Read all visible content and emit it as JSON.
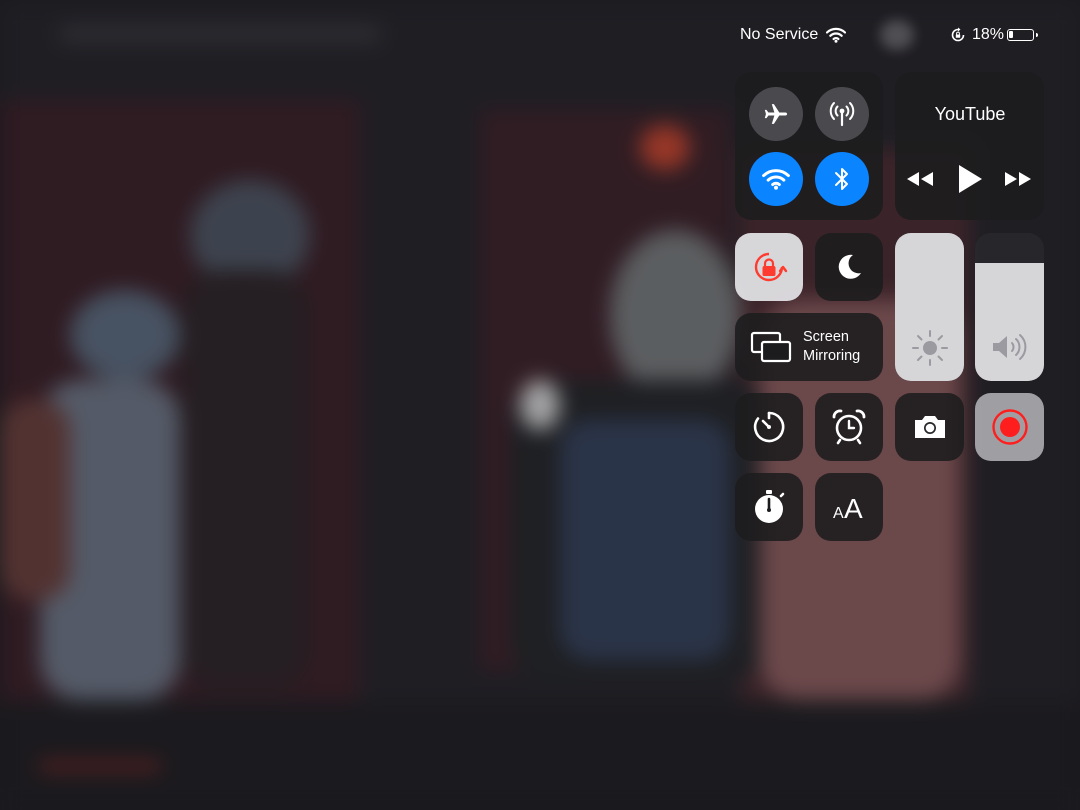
{
  "status_bar": {
    "carrier": "No Service",
    "battery_percent": "18%",
    "battery_level": 0.18,
    "icons": [
      "wifi-icon",
      "orientation-lock-icon",
      "battery-icon"
    ]
  },
  "control_center": {
    "connectivity": {
      "airplane_mode": false,
      "cellular_data": false,
      "wifi": true,
      "bluetooth": true,
      "active_color": "#0a84ff"
    },
    "now_playing": {
      "app": "YouTube",
      "controls": [
        "rewind-icon",
        "play-icon",
        "fast-forward-icon"
      ]
    },
    "orientation_lock": {
      "on": true,
      "accent_color": "#ff3b30"
    },
    "do_not_disturb": {
      "on": false
    },
    "screen_mirroring": {
      "line1": "Screen",
      "line2": "Mirroring"
    },
    "brightness_level": 1.0,
    "volume_level": 0.8,
    "shortcuts": [
      "timer-icon",
      "alarm-icon",
      "camera-icon",
      "screen-recording-icon",
      "stopwatch-icon",
      "text-size-icon"
    ],
    "text_size_label": "AA",
    "record_color": "#ff1e1e"
  }
}
